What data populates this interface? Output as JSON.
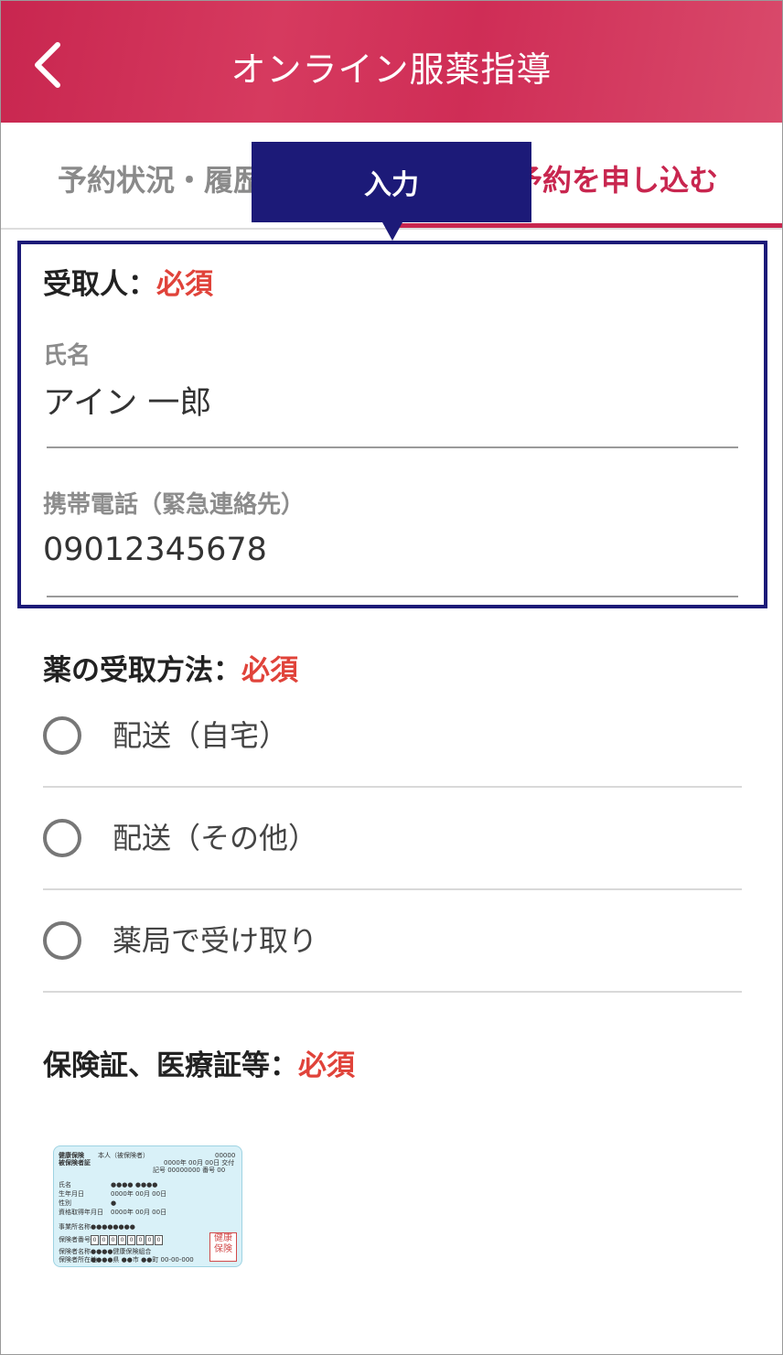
{
  "header": {
    "title": "オンライン服薬指導"
  },
  "tabs": {
    "left_label": "予約状況・履歴",
    "right_label": "予約を申し込む"
  },
  "callout": {
    "text": "入力"
  },
  "recipient": {
    "heading": "受取人：",
    "required": "必須",
    "name_label": "氏名",
    "name_value": "アイン 一郎",
    "phone_label": "携帯電話（緊急連絡先）",
    "phone_value": "09012345678"
  },
  "delivery": {
    "heading": "薬の受取方法：",
    "required": "必須",
    "options": [
      {
        "label": "配送（自宅）",
        "selected": false
      },
      {
        "label": "配送（その他）",
        "selected": false
      },
      {
        "label": "薬局で受け取り",
        "selected": false
      }
    ]
  },
  "insurance": {
    "heading": "保険証、医療証等：",
    "required": "必須",
    "card": {
      "title1": "健康保険",
      "title2": "被保険者証",
      "holder": "本人（被保険者）",
      "num": "00000",
      "date_issued": "0000年 00月 00日 交付",
      "symbol": "記号 00000000  番号 00",
      "name_label": "氏名",
      "name_value": "●●●●  ●●●●",
      "birth_label": "生年月日",
      "birth_value": "0000年  00月  00日",
      "sex_label": "性別",
      "sex_value": "●",
      "qualify_label": "資格取得年月日",
      "qualify_value": "0000年  00月  00日",
      "employer_label": "事業所名称",
      "employer_value": "●●●●●●●●",
      "insurer_no_label": "保険者番号",
      "insurer_no_digits": [
        "0",
        "0",
        "0",
        "0",
        "0",
        "0",
        "0",
        "0"
      ],
      "insurer_name_label": "保険者名称",
      "insurer_name_value": "●●●●健康保険組合",
      "insurer_addr_label": "保険者所在地",
      "insurer_addr_value": "●●●●県 ●●市 ●●町 00-00-000",
      "stamp": "健康保険"
    }
  }
}
